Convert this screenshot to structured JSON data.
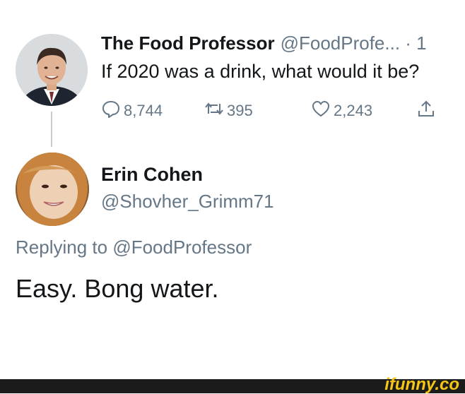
{
  "original_tweet": {
    "author_name": "The Food Professor",
    "author_handle": "@FoodProfe... · 1",
    "text": "If 2020 was a drink, what would it be?",
    "stats": {
      "replies": "8,744",
      "retweets": "395",
      "likes": "2,243"
    },
    "icons": [
      "reply-icon",
      "retweet-icon",
      "like-icon",
      "share-icon"
    ]
  },
  "reply": {
    "author_name": "Erin Cohen",
    "author_handle": "@Shovher_Grimm71",
    "replying_prefix": "Replying to",
    "replying_to": "@FoodProfessor",
    "text": "Easy. Bong water."
  },
  "watermark": {
    "text": "ifunny.co"
  },
  "colors": {
    "text": "#14171a",
    "muted": "#657786",
    "footer": "#1b1b1b",
    "watermark": "#f5c518"
  }
}
